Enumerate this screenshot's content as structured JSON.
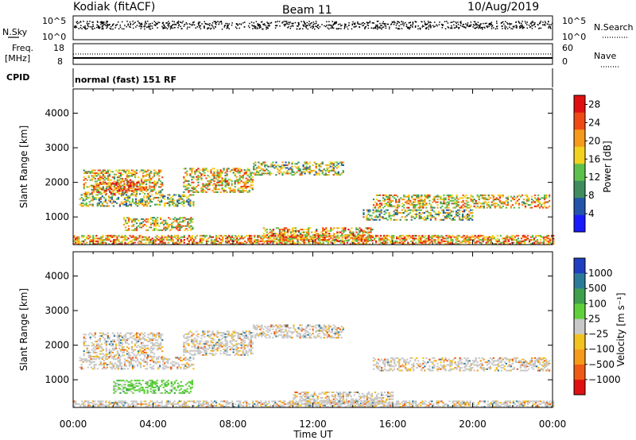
{
  "header": {
    "station": "Kodiak (fitACF)",
    "beam": "Beam 11",
    "date": "10/Aug/2019"
  },
  "top_panels": {
    "nsky_label": "N.Sky",
    "nsky_ticks": [
      "10^5",
      "10^0"
    ],
    "nsearch_label": "N.Search",
    "freq_label": "Freq.",
    "freq_unit": "[MHz]",
    "freq_ticks": [
      "18",
      "8"
    ],
    "nave_label": "Nave",
    "nave_ticks": [
      "60",
      "0"
    ],
    "cpid_label": "CPID",
    "cpid_text": "normal (fast) 151 RF"
  },
  "chart_data": [
    {
      "type": "heatmap",
      "title": "",
      "ylabel": "Slant Range [km]",
      "xlabel": "Time UT",
      "x_ticks": [
        "00:00",
        "04:00",
        "08:00",
        "12:00",
        "16:00",
        "20:00",
        "00:00"
      ],
      "x_range_hours": [
        0,
        24
      ],
      "y_ticks": [
        1000,
        2000,
        3000,
        4000
      ],
      "ylim": [
        200,
        4700
      ],
      "colorbar": {
        "label": "Power [dB]",
        "ticks": [
          "4",
          "8",
          "12",
          "16",
          "20",
          "24",
          "28"
        ],
        "range": [
          0,
          30
        ],
        "colors": [
          "#1a1aff",
          "#2255aa",
          "#3f8c5f",
          "#5ec04c",
          "#f2d21e",
          "#f59a1a",
          "#ef4a16",
          "#e01010"
        ]
      },
      "echo_regions": [
        {
          "t0": 0.3,
          "t1": 6.0,
          "r0": 1300,
          "r1": 1650,
          "level": 0.45
        },
        {
          "t0": 0.5,
          "t1": 4.5,
          "r0": 1650,
          "r1": 2350,
          "level": 0.6
        },
        {
          "t0": 1.0,
          "t1": 3.5,
          "r0": 1700,
          "r1": 2000,
          "level": 0.8
        },
        {
          "t0": 2.5,
          "t1": 6.0,
          "r0": 600,
          "r1": 1000,
          "level": 0.55
        },
        {
          "t0": 5.5,
          "t1": 9.0,
          "r0": 1700,
          "r1": 2400,
          "level": 0.6
        },
        {
          "t0": 9.0,
          "t1": 13.5,
          "r0": 2200,
          "r1": 2600,
          "level": 0.5
        },
        {
          "t0": 9.5,
          "t1": 15.0,
          "r0": 300,
          "r1": 700,
          "level": 0.65
        },
        {
          "t0": 15.0,
          "t1": 23.8,
          "r0": 1250,
          "r1": 1650,
          "level": 0.6
        },
        {
          "t0": 14.5,
          "t1": 20.0,
          "r0": 900,
          "r1": 1200,
          "level": 0.45
        },
        {
          "t0": 0.0,
          "t1": 24.0,
          "r0": 200,
          "r1": 450,
          "level": 0.7
        }
      ]
    },
    {
      "type": "heatmap",
      "title": "",
      "ylabel": "Slant Range [km]",
      "xlabel": "Time UT",
      "x_ticks": [
        "00:00",
        "04:00",
        "08:00",
        "12:00",
        "16:00",
        "20:00",
        "00:00"
      ],
      "x_range_hours": [
        0,
        24
      ],
      "y_ticks": [
        1000,
        2000,
        3000,
        4000
      ],
      "ylim": [
        200,
        4700
      ],
      "colorbar": {
        "label": "Velocity [m s⁻¹]",
        "ticks": [
          "1000",
          "500",
          "100",
          "25",
          "−25",
          "−100",
          "−500",
          "−1000"
        ],
        "colors": [
          "#1f3fc0",
          "#2c7a9a",
          "#3f9f4c",
          "#5fd03c",
          "#c8c8c8",
          "#f2c21e",
          "#f59a1a",
          "#ef5a16",
          "#e01010"
        ]
      },
      "echo_regions": [
        {
          "t0": 0.3,
          "t1": 6.0,
          "r0": 1300,
          "r1": 1650,
          "level": 0.45
        },
        {
          "t0": 0.5,
          "t1": 4.5,
          "r0": 1650,
          "r1": 2350,
          "level": 0.5
        },
        {
          "t0": 2.0,
          "t1": 6.0,
          "r0": 600,
          "r1": 1000,
          "level": 0.3
        },
        {
          "t0": 5.5,
          "t1": 9.0,
          "r0": 1700,
          "r1": 2400,
          "level": 0.5
        },
        {
          "t0": 9.0,
          "t1": 13.5,
          "r0": 2200,
          "r1": 2600,
          "level": 0.5
        },
        {
          "t0": 11.0,
          "t1": 16.0,
          "r0": 300,
          "r1": 650,
          "level": 0.5
        },
        {
          "t0": 15.0,
          "t1": 23.8,
          "r0": 1250,
          "r1": 1650,
          "level": 0.5
        },
        {
          "t0": 0.0,
          "t1": 24.0,
          "r0": 200,
          "r1": 400,
          "level": 0.5
        }
      ]
    }
  ]
}
